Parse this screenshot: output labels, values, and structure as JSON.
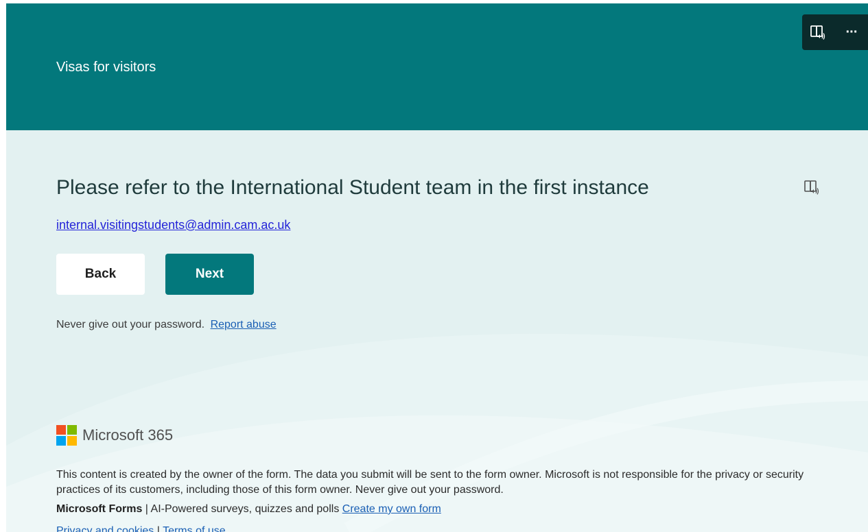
{
  "banner": {
    "title": "Visas for visitors"
  },
  "toolbar": {
    "immersive_reader_icon": "immersive-reader-icon",
    "more_icon": "more-options-icon",
    "more_glyph": "···"
  },
  "question": {
    "title": "Please refer to the International Student team in the first instance",
    "email": "internal.visitingstudents@admin.cam.ac.uk"
  },
  "navigation": {
    "back_label": "Back",
    "next_label": "Next"
  },
  "notice": {
    "password_text": "Never give out your password.",
    "report_link": "Report abuse"
  },
  "footer": {
    "brand": "Microsoft 365",
    "disclaimer": "This content is created by the owner of the form. The data you submit will be sent to the form owner. Microsoft is not responsible for the privacy or security practices of its customers, including those of this form owner. Never give out your password.",
    "product_name": "Microsoft Forms",
    "product_tagline": "| AI-Powered surveys, quizzes and polls",
    "create_link": "Create my own form",
    "privacy_link": "Privacy and cookies",
    "separator": "|",
    "terms_link": "Terms of use"
  },
  "colors": {
    "banner": "#03787c",
    "background": "#e3f1f1",
    "toolbar": "#0b2a2b",
    "logo_red": "#f25022",
    "logo_green": "#7fba00",
    "logo_blue": "#00a4ef",
    "logo_yellow": "#ffb900"
  }
}
